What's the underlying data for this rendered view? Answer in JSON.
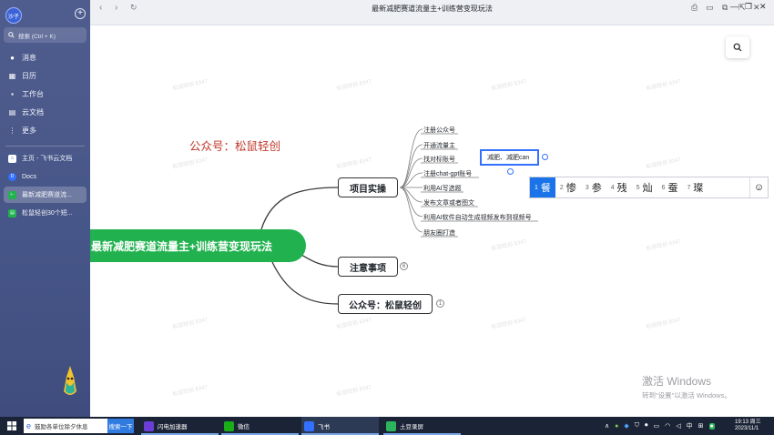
{
  "sidebar": {
    "avatar_text": "沙子",
    "search_placeholder": "搜索 (Ctrl + K)",
    "items": [
      {
        "label": "消息",
        "icon": "chat-icon"
      },
      {
        "label": "日历",
        "icon": "calendar-icon"
      },
      {
        "label": "工作台",
        "icon": "grid-icon"
      },
      {
        "label": "云文档",
        "icon": "document-icon"
      },
      {
        "label": "更多",
        "icon": "more-icon"
      }
    ],
    "recent": [
      {
        "label": "主页 - 飞书云文档"
      },
      {
        "label": "Docs"
      },
      {
        "label": "最新减肥赛道流..."
      },
      {
        "label": "松鼠轻创30个短..."
      }
    ]
  },
  "window": {
    "title": "最新减肥赛道流量主+训练营变现玩法"
  },
  "mindmap": {
    "overlay_title": "公众号：松鼠轻创",
    "root": "最新减肥赛道流量主+训练营变现玩法",
    "branches": [
      {
        "label": "项目实操"
      },
      {
        "label": "注意事项",
        "badge": "6"
      },
      {
        "label": "公众号：松鼠轻创",
        "badge": "1"
      }
    ],
    "leaves": [
      "注册公众号",
      "开通流量主",
      "找对标账号",
      "注册chat-gpt账号",
      "利用AI写选题",
      "发布文章或者图文",
      "利用AI软件自动生成视频发布到视频号",
      "朋友圈打造"
    ],
    "watermark": "松鼠轻创 8347"
  },
  "editor": {
    "input_value": "减肥、减肥can"
  },
  "ime": {
    "candidates": [
      {
        "n": "1",
        "c": "餐"
      },
      {
        "n": "2",
        "c": "惨"
      },
      {
        "n": "3",
        "c": "参"
      },
      {
        "n": "4",
        "c": "残"
      },
      {
        "n": "5",
        "c": "灿"
      },
      {
        "n": "6",
        "c": "蚕"
      },
      {
        "n": "7",
        "c": "璨"
      }
    ],
    "emoji": "☺"
  },
  "activation": {
    "line1": "激活 Windows",
    "line2": "转到\"设置\"以激活 Windows。"
  },
  "taskbar": {
    "search_text": "鼓励各单位除夕休息",
    "search_button": "搜索一下",
    "apps": [
      {
        "label": "闪电加速器",
        "color": "#6b3fd6"
      },
      {
        "label": "微信",
        "color": "#1aad19"
      },
      {
        "label": "飞书",
        "color": "#3370ff"
      },
      {
        "label": "土豆录屏",
        "color": "#2db55d"
      }
    ],
    "ime_indicator": "中",
    "time": "19:13 周三",
    "date": "2023/11/1"
  }
}
